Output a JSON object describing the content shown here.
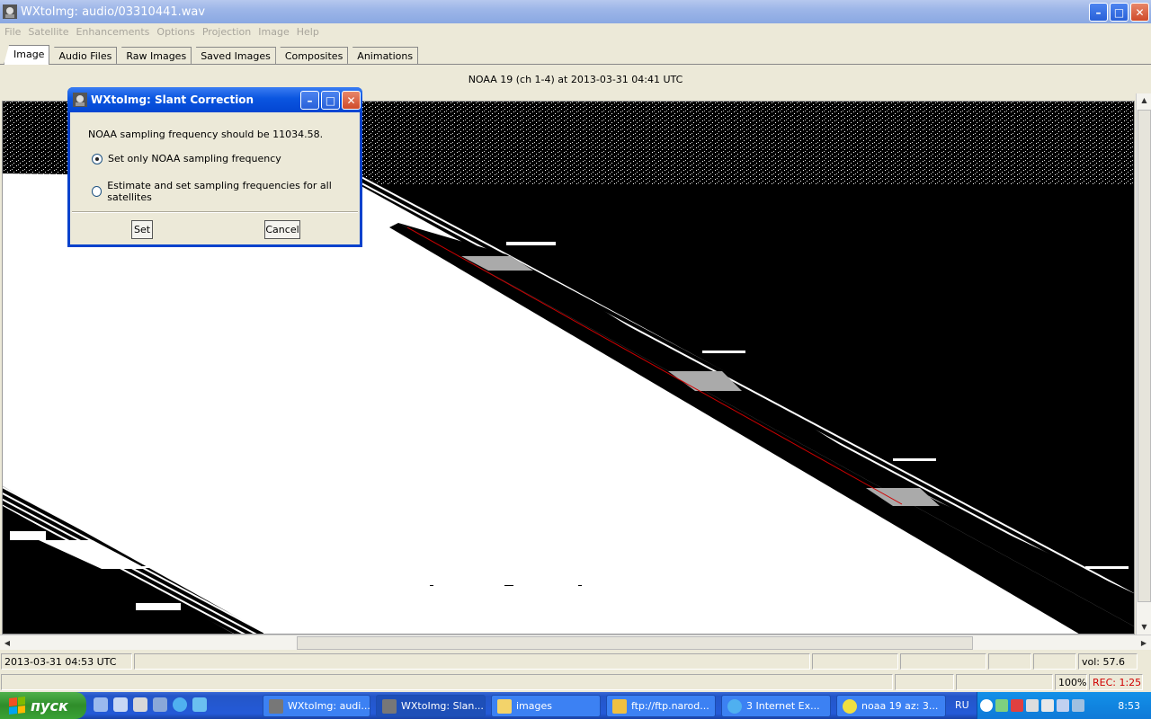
{
  "window": {
    "title": "WXtoImg: audio/03310441.wav"
  },
  "menu": [
    "File",
    "Satellite",
    "Enhancements",
    "Options",
    "Projection",
    "Image",
    "Help"
  ],
  "tabs": [
    "Image",
    "Audio Files",
    "Raw Images",
    "Saved Images",
    "Composites",
    "Animations"
  ],
  "image_caption": "NOAA 19 (ch 1-4) at 2013-03-31  04:41 UTC",
  "dialog": {
    "title": "WXtoImg: Slant Correction",
    "message": "NOAA sampling frequency should be 11034.58.",
    "option1": "Set only NOAA sampling frequency",
    "option2": "Estimate and set sampling frequencies for all satellites",
    "selected_option": 1,
    "set_label": "Set",
    "cancel_label": "Cancel"
  },
  "status": {
    "time": "2013-03-31  04:53 UTC",
    "volume": "vol: 57.6",
    "zoom": "100%",
    "rec": "REC: 1:25"
  },
  "taskbar": {
    "start_label": "пуск",
    "tasks": [
      "WXtoImg: audi...",
      "WXtoImg: Slan...",
      "images",
      "ftp://ftp.narod...",
      "3 Internet Ex...",
      "noaa 19  az: 3..."
    ],
    "lang": "RU",
    "clock": "8:53"
  },
  "colors": {
    "accent_red": "#d00000",
    "title_blue": "#0a55e0"
  }
}
